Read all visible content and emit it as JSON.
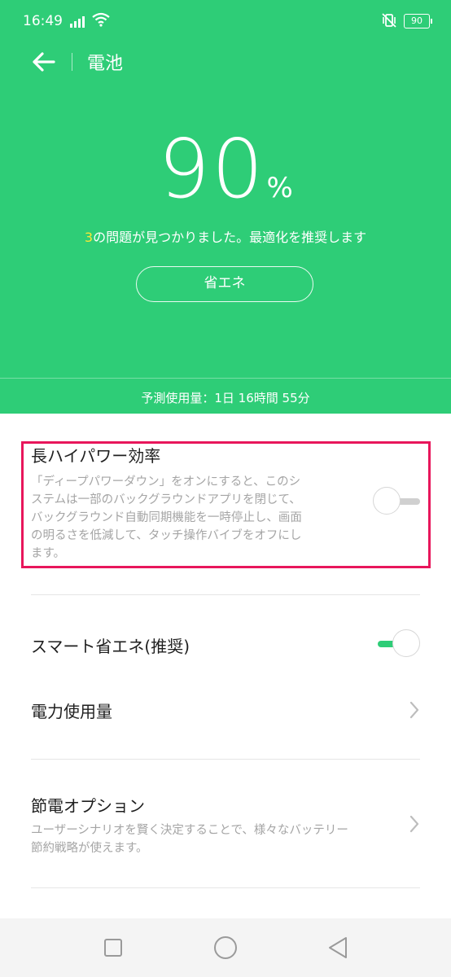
{
  "status": {
    "time": "16:49",
    "battery": "90"
  },
  "header": {
    "title": "電池"
  },
  "battery": {
    "percent": "90",
    "unit": "%"
  },
  "issues": {
    "count": "3",
    "text": "の問題が見つかりました。最適化を推奨します"
  },
  "eco_button": "省エネ",
  "prediction": "予測使用量：1日 16時間 55分",
  "settings": {
    "long_power": {
      "title": "長ハイパワー効率",
      "desc_lines": [
        "「ディープパワーダウン」をオンにすると、このシ",
        "ステムは一部のバックグラウンドアプリを閉じて、",
        "バックグラウンド自動同期機能を一時停止し、画面",
        "の明るさを低減して、タッチ操作バイブをオフにし",
        "ます。"
      ],
      "enabled": false
    },
    "smart_eco": {
      "title": "スマート省エネ(推奨)",
      "enabled": true
    },
    "power_usage": {
      "title": "電力使用量"
    },
    "saving_options": {
      "title": "節電オプション",
      "desc_lines": [
        "ユーザーシナリオを賢く決定することで、様々なバッテリー",
        "節約戦略が使えます。"
      ]
    }
  },
  "colors": {
    "accent": "#2ecd77",
    "highlight": "#e8165b",
    "issue_count": "#f7e838"
  },
  "icons": {
    "back": "back-arrow-icon",
    "nav": [
      "recent-apps-icon",
      "home-icon",
      "back-triangle-icon"
    ]
  }
}
